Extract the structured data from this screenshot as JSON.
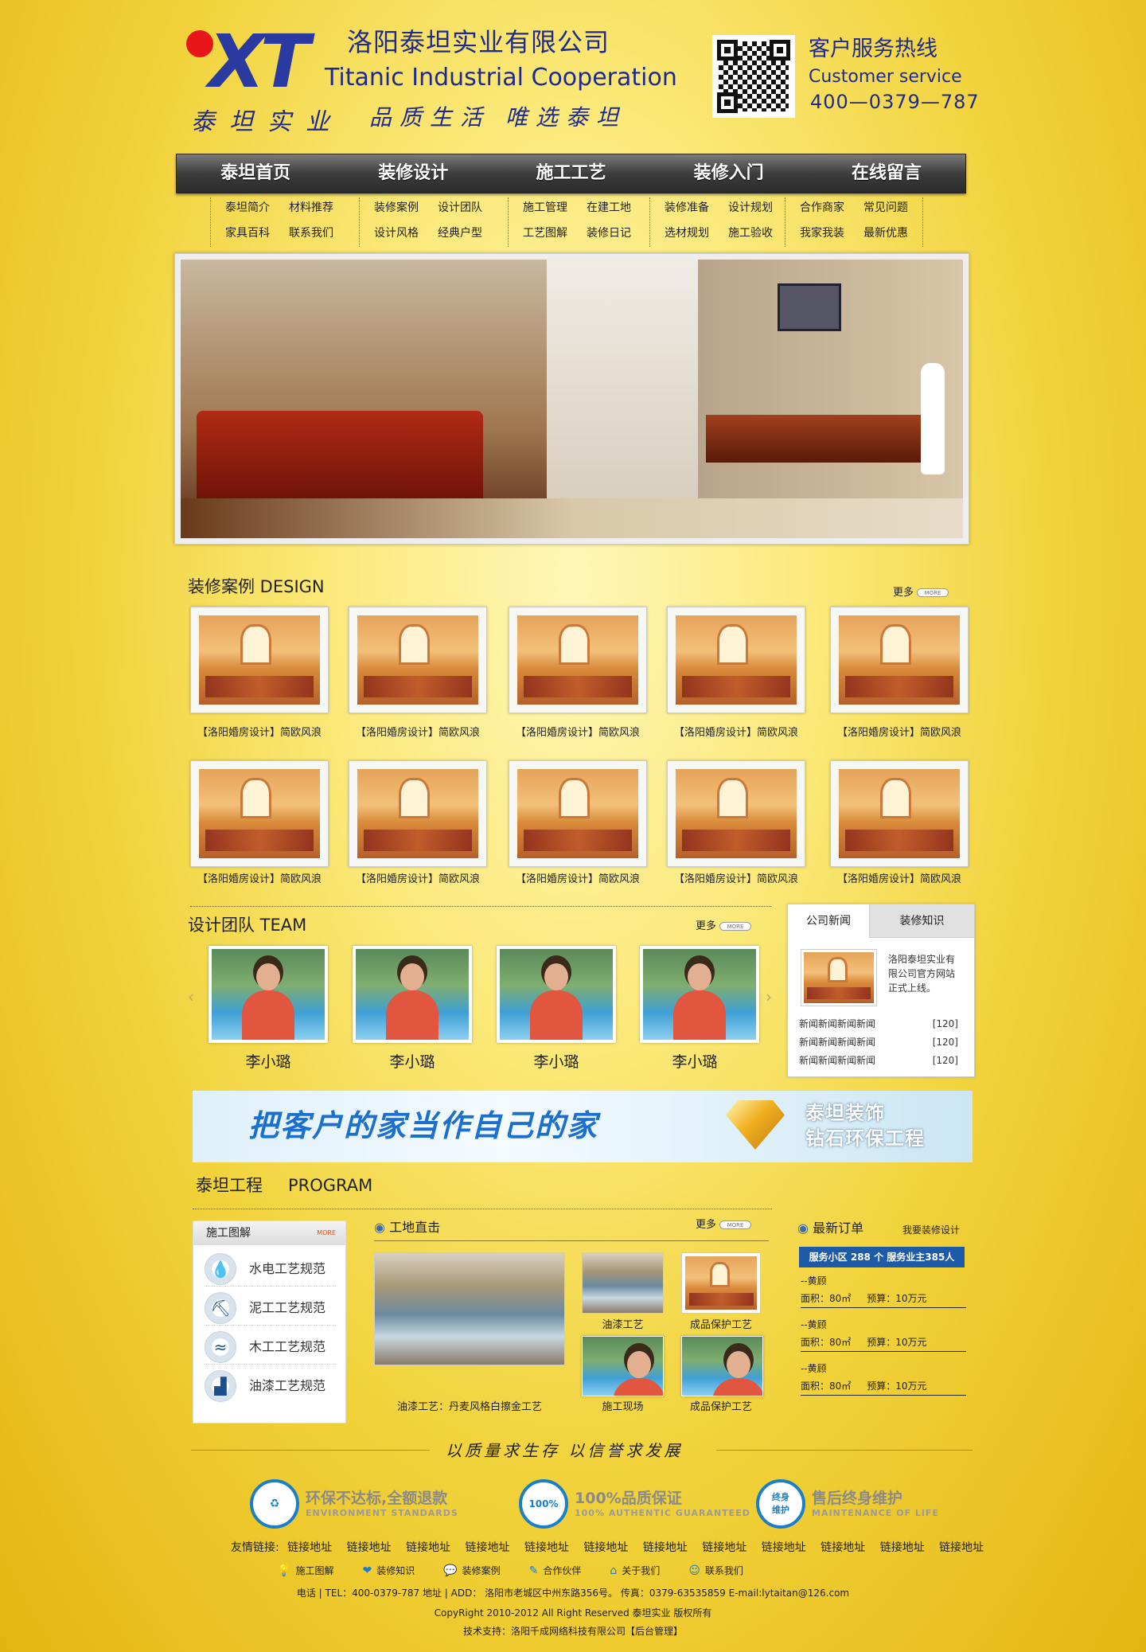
{
  "header": {
    "logo_text": "XT",
    "company_cn": "洛阳泰坦实业有限公司",
    "company_en": "Titanic Industrial Cooperation",
    "slogan_left": "泰坦实业",
    "slogan_right": "品质生活 唯选泰坦",
    "hotline_title": "客户服务热线",
    "hotline_en": "Customer service",
    "hotline_number": "400—0379—787"
  },
  "nav": {
    "items": [
      "泰坦首页",
      "装修设计",
      "施工工艺",
      "装修入门",
      "在线留言"
    ],
    "sub": [
      [
        "泰坦简介",
        "材料推荐",
        "家具百科",
        "联系我们"
      ],
      [
        "装修案例",
        "设计团队",
        "设计风格",
        "经典户型"
      ],
      [
        "施工管理",
        "在建工地",
        "工艺图解",
        "装修日记"
      ],
      [
        "装修准备",
        "设计规划",
        "选材规划",
        "施工验收"
      ],
      [
        "合作商家",
        "常见问题",
        "我家我装",
        "最新优惠"
      ]
    ]
  },
  "design": {
    "title": "装修案例 DESIGN",
    "more": "更多",
    "more_btn": "MORE",
    "captions": [
      "【洛阳婚房设计】简欧风浪",
      "【洛阳婚房设计】简欧风浪",
      "【洛阳婚房设计】简欧风浪",
      "【洛阳婚房设计】简欧风浪",
      "【洛阳婚房设计】简欧风浪",
      "【洛阳婚房设计】简欧风浪",
      "【洛阳婚房设计】简欧风浪",
      "【洛阳婚房设计】简欧风浪",
      "【洛阳婚房设计】简欧风浪",
      "【洛阳婚房设计】简欧风浪"
    ]
  },
  "team": {
    "title": "设计团队 TEAM",
    "more": "更多",
    "more_btn": "MORE",
    "members": [
      "李小璐",
      "李小璐",
      "李小璐",
      "李小璐"
    ],
    "prev": "‹",
    "next": "›"
  },
  "news": {
    "tab1": "公司新闻",
    "tab2": "装修知识",
    "feature": "洛阳泰坦实业有限公司官方网站正式上线。",
    "items": [
      {
        "title": "新闻新闻新闻新闻",
        "count": "[120]"
      },
      {
        "title": "新闻新闻新闻新闻",
        "count": "[120]"
      },
      {
        "title": "新闻新闻新闻新闻",
        "count": "[120]"
      }
    ]
  },
  "banner2": {
    "main": "把客户的家当作自己的家",
    "line1": "泰坦装饰",
    "line2": "钻石环保工程"
  },
  "program": {
    "title": "泰坦工程",
    "title_en": "PROGRAM",
    "process_title": "施工图解",
    "process_more": "MORE",
    "process": [
      {
        "icon": "water-drop-icon",
        "glyph": "💧",
        "label": "水电工艺规范"
      },
      {
        "icon": "trowel-icon",
        "glyph": "⛏",
        "label": "泥工工艺规范"
      },
      {
        "icon": "saw-icon",
        "glyph": "🪚",
        "label": "木工工艺规范"
      },
      {
        "icon": "paint-roller-icon",
        "glyph": "🖌",
        "label": "油漆工艺规范"
      }
    ],
    "site_title": "工地直击",
    "site_more": "更多",
    "site_more_btn": "MORE",
    "site_main_caption": "油漆工艺：丹麦风格白擦金工艺",
    "site_captions": [
      "油漆工艺",
      "成品保护工艺",
      "施工现场",
      "成品保护工艺"
    ],
    "orders_title": "最新订单",
    "orders_link": "我要装修设计",
    "orders_summary": "服务小区 288 个   服务业主385人",
    "orders": [
      {
        "name": "--黄顾",
        "area": "面积：80㎡",
        "budget": "预算：10万元"
      },
      {
        "name": "--黄顾",
        "area": "面积：80㎡",
        "budget": "预算：10万元"
      },
      {
        "name": "--黄顾",
        "area": "面积：80㎡",
        "budget": "预算：10万元"
      }
    ]
  },
  "footer": {
    "motto": "以质量求生存  以信誉求发展",
    "badges": [
      {
        "icon": "eco-icon",
        "glyph": "♻",
        "title": "环保不达标,全额退款",
        "sub": "ENVIRONMENT STANDARDS"
      },
      {
        "icon": "quality-icon",
        "glyph": "100%",
        "title": "100%品质保证",
        "sub": "100% AUTHENTIC GUARANTEED"
      },
      {
        "icon": "lifetime-icon",
        "glyph": "终身维护",
        "title": "售后终身维护",
        "sub": "MAINTENANCE OF LIFE"
      }
    ],
    "links_label": "友情链接:",
    "links": [
      "链接地址",
      "链接地址",
      "链接地址",
      "链接地址",
      "链接地址",
      "链接地址",
      "链接地址",
      "链接地址",
      "链接地址",
      "链接地址",
      "链接地址",
      "链接地址"
    ],
    "nav": [
      {
        "icon": "bulb-icon",
        "glyph": "💡",
        "label": "施工图解"
      },
      {
        "icon": "heart-icon",
        "glyph": "❤",
        "label": "装修知识"
      },
      {
        "icon": "chat-icon",
        "glyph": "💬",
        "label": "装修案例"
      },
      {
        "icon": "edit-icon",
        "glyph": "✎",
        "label": "合作伙伴"
      },
      {
        "icon": "home-icon",
        "glyph": "⌂",
        "label": "关于我们"
      },
      {
        "icon": "contact-icon",
        "glyph": "☺",
        "label": "联系我们"
      }
    ],
    "contact": "电话 | TEL：400-0379-787    地址 | ADD：  洛阳市老城区中州东路356号。  传真：0379-63535859   E-mail:lytaitan@126.com",
    "copyright": "CopyRight 2010-2012 All Right Reserved  泰坦实业  版权所有",
    "support": "技术支持：洛阳千成网络科技有限公司【后台管理】"
  }
}
